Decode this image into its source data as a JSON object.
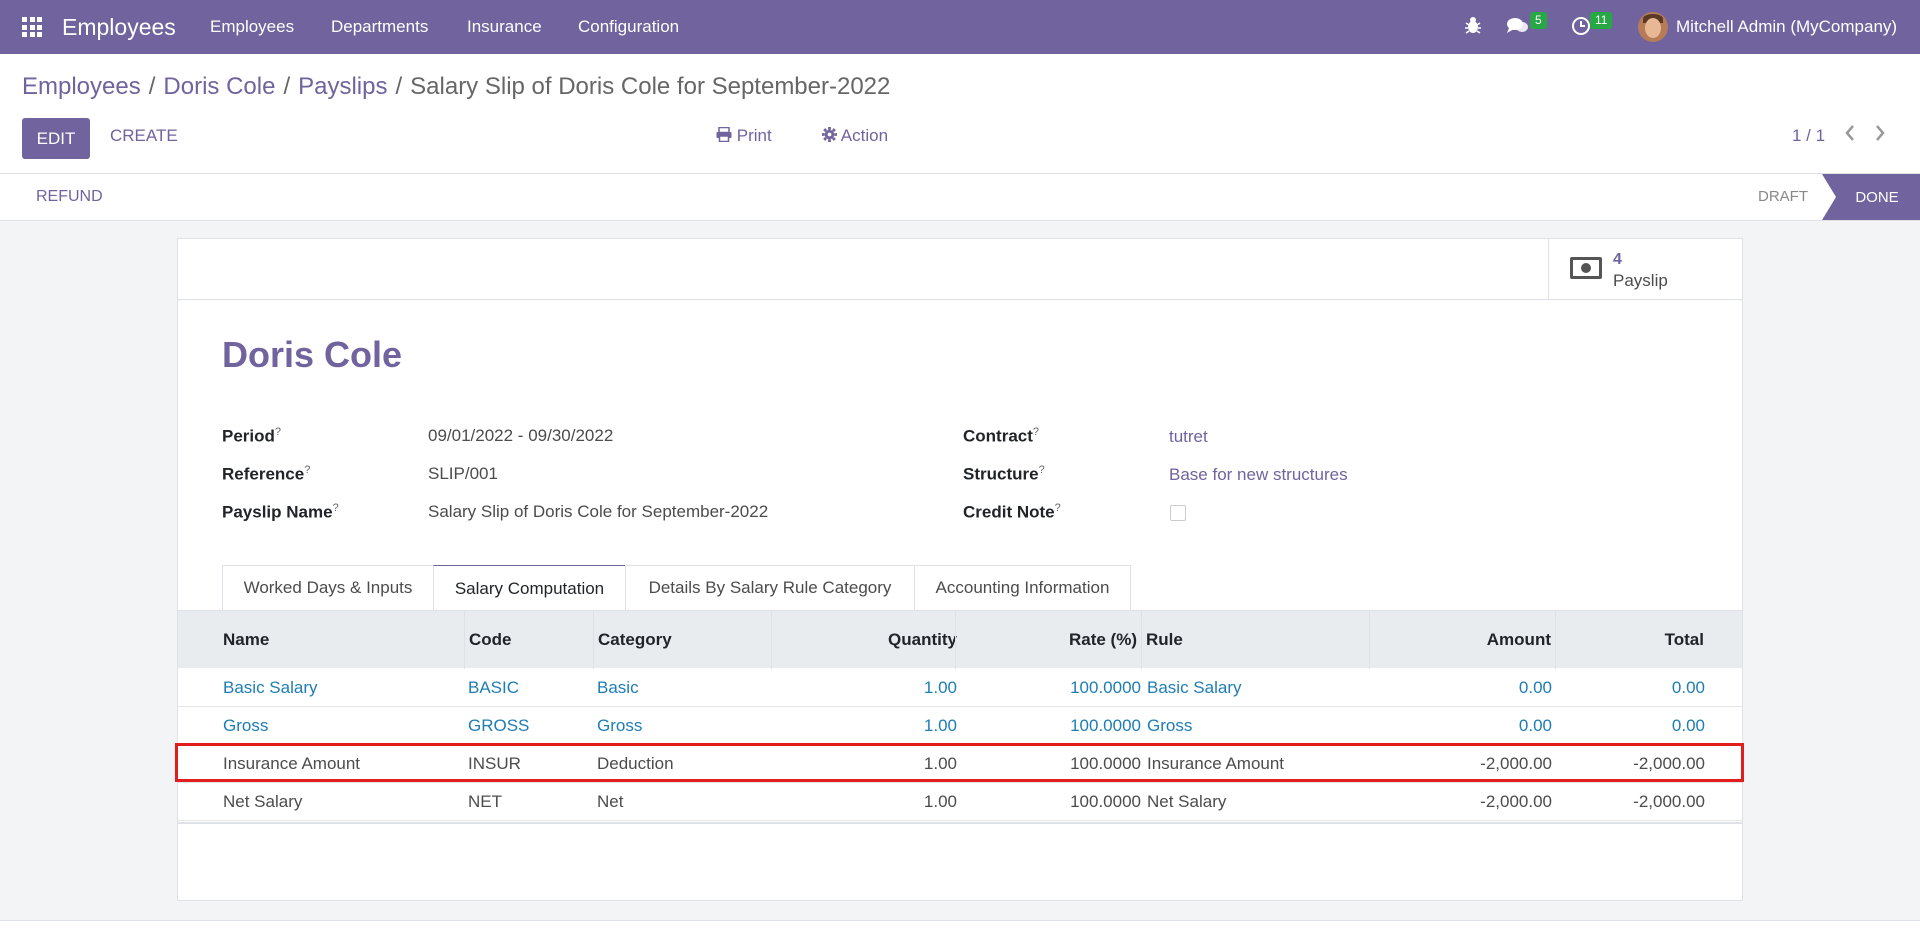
{
  "topbar": {
    "app_name": "Employees",
    "menu": [
      "Employees",
      "Departments",
      "Insurance",
      "Configuration"
    ],
    "chat_count": "5",
    "activity_count": "11",
    "user": "Mitchell Admin (MyCompany)",
    "bug_icon": "bug-icon",
    "chat_icon": "chat-icon",
    "clock_icon": "clock-icon"
  },
  "breadcrumb": {
    "items": [
      "Employees",
      "Doris Cole",
      "Payslips"
    ],
    "current": "Salary Slip of Doris Cole for September-2022"
  },
  "controls": {
    "edit": "EDIT",
    "create": "CREATE",
    "print": "Print",
    "action": "Action",
    "pager": "1 / 1"
  },
  "statusbar": {
    "refund": "REFUND",
    "states": [
      "DRAFT",
      "DONE"
    ],
    "active_state": "DONE"
  },
  "stat_button": {
    "count": "4",
    "label": "Payslip"
  },
  "form": {
    "employee": "Doris Cole",
    "left": [
      {
        "label": "Period",
        "value": "09/01/2022 - 09/30/2022"
      },
      {
        "label": "Reference",
        "value": "SLIP/001"
      },
      {
        "label": "Payslip Name",
        "value": "Salary Slip of Doris Cole for September-2022"
      }
    ],
    "right": [
      {
        "label": "Contract",
        "value": "tutret"
      },
      {
        "label": "Structure",
        "value": "Base for new structures"
      },
      {
        "label": "Credit Note",
        "value": ""
      }
    ],
    "help_mark": "?"
  },
  "tabs": [
    "Worked Days & Inputs",
    "Salary Computation",
    "Details By Salary Rule Category",
    "Accounting Information"
  ],
  "active_tab": "Salary Computation",
  "table": {
    "headers": [
      "Name",
      "Code",
      "Category",
      "Quantity",
      "Rate (%)",
      "Rule",
      "Amount",
      "Total"
    ],
    "rows": [
      [
        "Basic Salary",
        "BASIC",
        "Basic",
        "1.00",
        "100.0000",
        "Basic Salary",
        "0.00",
        "0.00"
      ],
      [
        "Gross",
        "GROSS",
        "Gross",
        "1.00",
        "100.0000",
        "Gross",
        "0.00",
        "0.00"
      ],
      [
        "Insurance Amount",
        "INSUR",
        "Deduction",
        "1.00",
        "100.0000",
        "Insurance Amount",
        "-2,000.00",
        "-2,000.00"
      ],
      [
        "Net Salary",
        "NET",
        "Net",
        "1.00",
        "100.0000",
        "Net Salary",
        "-2,000.00",
        "-2,000.00"
      ]
    ]
  },
  "colors": {
    "brand": "#71639e",
    "link": "#1e7db5",
    "highlight": "#e11d1d",
    "badge": "#28a745"
  }
}
